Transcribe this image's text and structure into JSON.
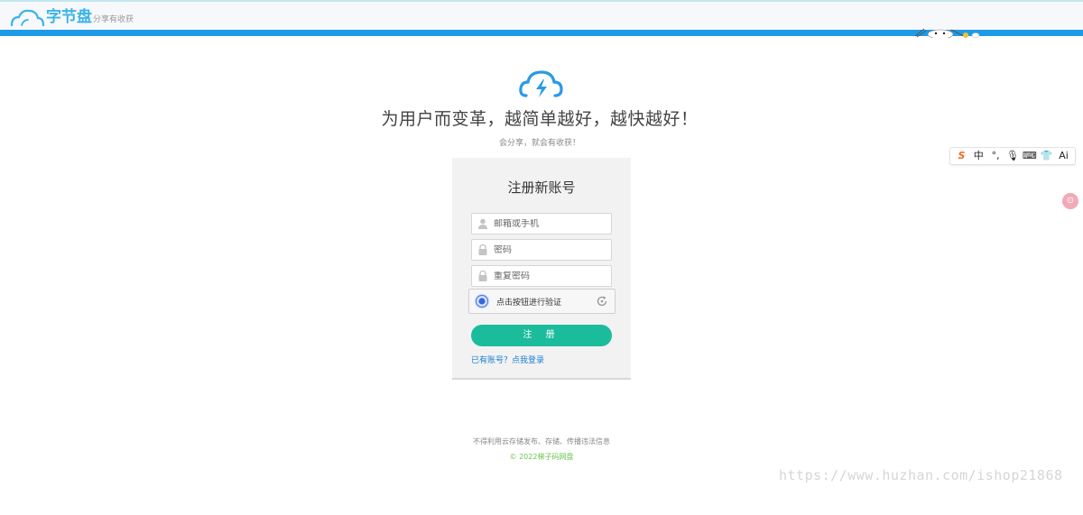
{
  "header": {
    "logo_text": "字节盘",
    "slogan": "分享有收获"
  },
  "hero": {
    "title": "为用户而变革，越简单越好，越快越好！",
    "subtitle": "会分享，就会有收获！"
  },
  "register": {
    "title": "注册新账号",
    "account_placeholder": "邮箱或手机",
    "password_placeholder": "密码",
    "repeat_password_placeholder": "重复密码",
    "captcha_text": "点击按钮进行验证",
    "submit_label": "注 册",
    "login_link": "已有账号？点我登录"
  },
  "footer": {
    "notice": "不得利用云存储发布、存储、传播违法信息",
    "copyright": "© 2022梯子码网盘"
  },
  "watermark": "https://www.huzhan.com/ishop21868",
  "ime_toolbar": {
    "items": [
      "S",
      "中",
      "°,",
      "🎙",
      "⌨",
      "👕",
      "Ai"
    ]
  },
  "float_badge": "⊙",
  "colors": {
    "brand_blue": "#1e9be8",
    "button_green": "#1bbc9b",
    "link_blue": "#1a7fd4",
    "copyright_green": "#6cc34c"
  }
}
